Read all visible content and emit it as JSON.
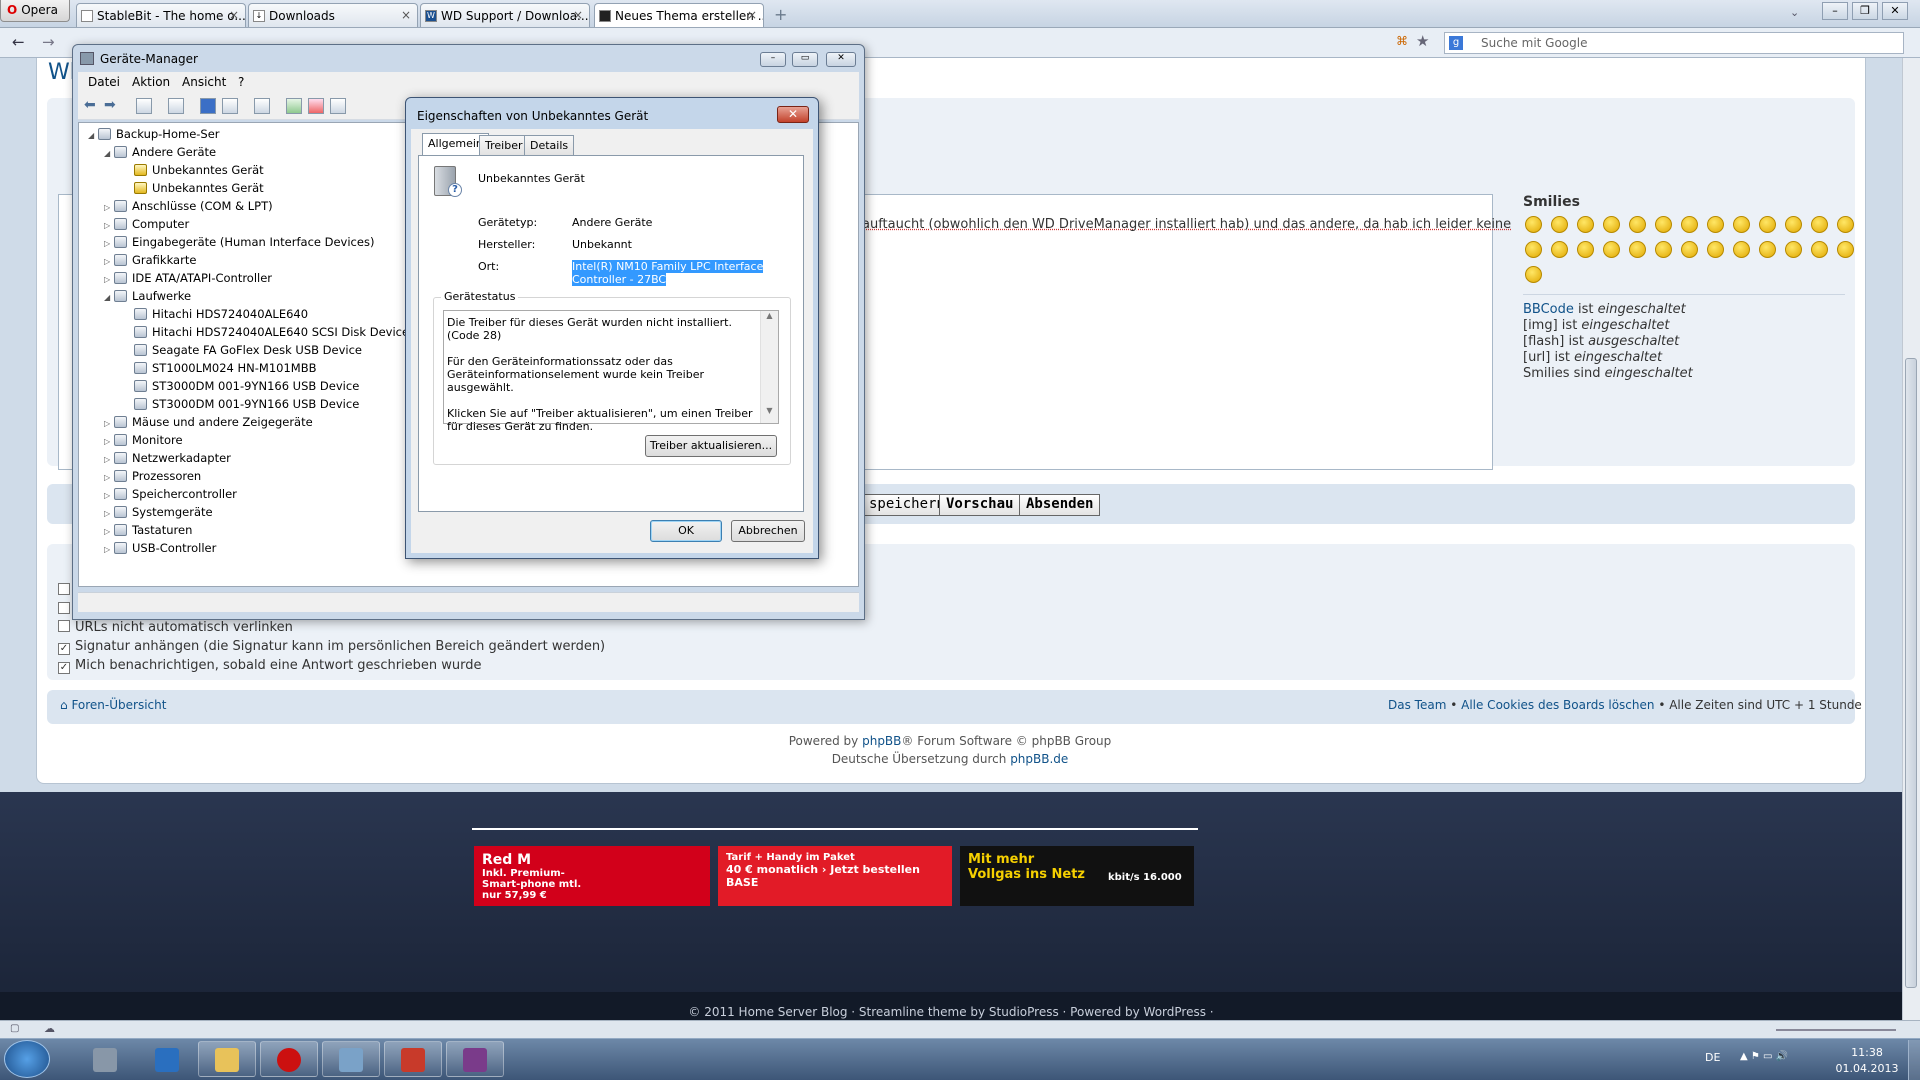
{
  "browser": {
    "menu_label": "Opera",
    "tabs": [
      {
        "label": "StableBit - The home o...",
        "icon": "page-icon",
        "active": false
      },
      {
        "label": "Downloads",
        "icon": "download-icon",
        "active": false
      },
      {
        "label": "WD Support / Downloa...",
        "icon": "wd-icon",
        "active": false
      },
      {
        "label": "Neues Thema erstellen ...",
        "icon": "forum-icon",
        "active": true
      }
    ],
    "search_placeholder": "Suche mit Google",
    "accent": "#cc0000"
  },
  "forum": {
    "post_text": "auftaucht (obwohlich den WD DriveManager installiert hab) und das andere, da hab ich leider keine",
    "buttons": {
      "save": "speichern",
      "preview": "Vorschau",
      "submit": "Absenden"
    },
    "smilies_title": "Smilies",
    "bbcode": [
      {
        "prefix": "BBCode",
        "suffix": " ist ",
        "state": "eingeschaltet"
      },
      {
        "prefix": "[img]",
        "suffix": " ist ",
        "state": "eingeschaltet"
      },
      {
        "prefix": "[flash]",
        "suffix": " ist ",
        "state": "ausgeschaltet"
      },
      {
        "prefix": "[url]",
        "suffix": " ist ",
        "state": "eingeschaltet"
      },
      {
        "prefix": "Smilies sind",
        "suffix": " ",
        "state": "eingeschaltet"
      }
    ],
    "options": [
      {
        "label": "URLs nicht automatisch verlinken",
        "checked": false
      },
      {
        "label": "Signatur anhängen (die Signatur kann im persönlichen Bereich geändert werden)",
        "checked": true
      },
      {
        "label": "Mich benachrichtigen, sobald eine Antwort geschrieben wurde",
        "checked": true
      }
    ],
    "footer": {
      "index": "Foren-Übersicht",
      "team": "Das Team",
      "sep": " • ",
      "cookies": "Alle Cookies des Boards löschen",
      "times": "Alle Zeiten sind UTC + 1 Stunde",
      "powered_prefix": "Powered by ",
      "powered_link": "phpBB",
      "powered_suffix": "® Forum Software © phpBB Group",
      "translation_prefix": "Deutsche Übersetzung durch ",
      "translation_link": "phpBB.de"
    }
  },
  "blog_footer": {
    "copyright": "© 2011 Home Server Blog · Streamline theme by StudioPress · Powered by WordPress ·",
    "ads": [
      {
        "title": "Red M",
        "text": "Inkl. Premium-Smart-phone mtl. nur 57,99 €",
        "bg": "#d2001a"
      },
      {
        "title": "Tarif + Handy im Paket",
        "text": "40 € monatlich  › Jetzt bestellen  BASE",
        "bg": "#e21b27"
      },
      {
        "title": "Mit mehr Vollgas ins Netz",
        "text": "kbit/s 16.000",
        "bg": "#111111"
      }
    ]
  },
  "device_manager": {
    "title": "Geräte-Manager",
    "menu": [
      "Datei",
      "Aktion",
      "Ansicht",
      "?"
    ],
    "tree": [
      {
        "label": "Backup-Home-Ser",
        "level": 0,
        "expander": "◢",
        "warn": false
      },
      {
        "label": "Andere Geräte",
        "level": 1,
        "expander": "◢",
        "warn": false
      },
      {
        "label": "Unbekanntes Gerät",
        "level": 2,
        "expander": "",
        "warn": true
      },
      {
        "label": "Unbekanntes Gerät",
        "level": 2,
        "expander": "",
        "warn": true
      },
      {
        "label": "Anschlüsse (COM & LPT)",
        "level": 1,
        "expander": "▷",
        "warn": false
      },
      {
        "label": "Computer",
        "level": 1,
        "expander": "▷",
        "warn": false
      },
      {
        "label": "Eingabegeräte (Human Interface Devices)",
        "level": 1,
        "expander": "▷",
        "warn": false
      },
      {
        "label": "Grafikkarte",
        "level": 1,
        "expander": "▷",
        "warn": false
      },
      {
        "label": "IDE ATA/ATAPI-Controller",
        "level": 1,
        "expander": "▷",
        "warn": false
      },
      {
        "label": "Laufwerke",
        "level": 1,
        "expander": "◢",
        "warn": false
      },
      {
        "label": "Hitachi HDS724040ALE640",
        "level": 2,
        "expander": "",
        "warn": false
      },
      {
        "label": "Hitachi HDS724040ALE640 SCSI Disk Device",
        "level": 2,
        "expander": "",
        "warn": false
      },
      {
        "label": "Seagate FA GoFlex Desk USB Device",
        "level": 2,
        "expander": "",
        "warn": false
      },
      {
        "label": "ST1000LM024 HN-M101MBB",
        "level": 2,
        "expander": "",
        "warn": false
      },
      {
        "label": "ST3000DM 001-9YN166 USB Device",
        "level": 2,
        "expander": "",
        "warn": false
      },
      {
        "label": "ST3000DM 001-9YN166 USB Device",
        "level": 2,
        "expander": "",
        "warn": false
      },
      {
        "label": "Mäuse und andere Zeigegeräte",
        "level": 1,
        "expander": "▷",
        "warn": false
      },
      {
        "label": "Monitore",
        "level": 1,
        "expander": "▷",
        "warn": false
      },
      {
        "label": "Netzwerkadapter",
        "level": 1,
        "expander": "▷",
        "warn": false
      },
      {
        "label": "Prozessoren",
        "level": 1,
        "expander": "▷",
        "warn": false
      },
      {
        "label": "Speichercontroller",
        "level": 1,
        "expander": "▷",
        "warn": false
      },
      {
        "label": "Systemgeräte",
        "level": 1,
        "expander": "▷",
        "warn": false
      },
      {
        "label": "Tastaturen",
        "level": 1,
        "expander": "▷",
        "warn": false
      },
      {
        "label": "USB-Controller",
        "level": 1,
        "expander": "▷",
        "warn": false
      }
    ]
  },
  "properties": {
    "title": "Eigenschaften von Unbekanntes Gerät",
    "close": "✕",
    "tabs": [
      "Allgemein",
      "Treiber",
      "Details"
    ],
    "device_name": "Unbekanntes Gerät",
    "fields": [
      {
        "label": "Gerätetyp:",
        "value": "Andere Geräte"
      },
      {
        "label": "Hersteller:",
        "value": "Unbekannt"
      },
      {
        "label": "Ort:",
        "value": "Intel(R) NM10 Family LPC Interface Controller - 27BC"
      }
    ],
    "status_title": "Gerätestatus",
    "status_lines": [
      "Die Treiber für dieses Gerät wurden nicht installiert. (Code 28)",
      "Für den Geräteinformationssatz oder das Geräteinformationselement wurde kein Treiber ausgewählt.",
      "Klicken Sie auf \"Treiber aktualisieren\", um einen Treiber für dieses Gerät zu finden."
    ],
    "update_button": "Treiber aktualisieren...",
    "ok": "OK",
    "cancel": "Abbrechen"
  },
  "taskbar": {
    "lang": "DE",
    "time": "11:38",
    "date": "01.04.2013"
  }
}
